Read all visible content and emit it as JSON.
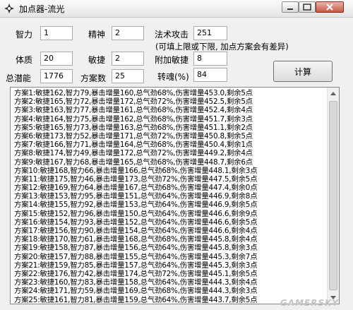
{
  "window": {
    "title": "加点器-流光"
  },
  "fields": {
    "zhili": {
      "label": "智力",
      "value": "1"
    },
    "jingshen": {
      "label": "精神",
      "value": "2"
    },
    "fashu": {
      "label": "法术攻击",
      "value": "251"
    },
    "tizhi": {
      "label": "体质",
      "value": "20"
    },
    "minjie": {
      "label": "敏捷",
      "value": "2"
    },
    "fujia": {
      "label": "附加敏捷",
      "value": "8"
    },
    "zongqianneng": {
      "label": "总潜能",
      "value": "1776"
    },
    "fanganshu": {
      "label": "方案数",
      "value": "25"
    },
    "zhuanhun": {
      "label": "转魂(%)",
      "value": "84"
    }
  },
  "hint": "(可填上限或下限, 加点方案会有差异)",
  "calc_button": "计算",
  "results": [
    "方案1:敏捷162,智力79,暴击增量160,总气劲68%,伤害增量453.0,剩余5点",
    "方案2:敏捷165,智力72,暴击增量172,总气劲72%,伤害增量452.5,剩余5点",
    "方案3:敏捷163,智力77,暴击增量161,总气劲68%,伤害增量452.4,剩余4点",
    "方案4:敏捷164,智力75,暴击增量162,总气劲68%,伤害增量451.7,剩余3点",
    "方案5:敏捷165,智力73,暴击增量163,总气劲68%,伤害增量451.1,剩余2点",
    "方案6:敏捷173,智力52,暴击增量171,总气劲72%,伤害增量450.8,剩余5点",
    "方案7:敏捷166,智力71,暴击增量164,总气劲68%,伤害增量450.4,剩余1点",
    "方案8:敏捷174,智力49,暴击增量172,总气劲72%,伤害增量449.2,剩余4点",
    "方案9:敏捷167,智力68,暴击增量165,总气劲68%,伤害增量448.7,剩余6点",
    "方案10:敏捷168,智力66,暴击增量166,总气劲68%,伤害增量448.1,剩余3点",
    "方案11:敏捷175,智力46,暴击增量173,总气劲72%,伤害增量447.5,剩余5点",
    "方案12:敏捷169,智力64,暴击增量167,总气劲68%,伤害增量447.4,剩余0点",
    "方案13:敏捷153,智力95,暴击增量151,总气劲64%,伤害增量446.9,剩余8点",
    "方案14:敏捷155,智力92,暴击增量153,总气劲64%,伤害增量446.9,剩余5点",
    "方案15:敏捷152,智力96,暴击增量150,总气劲64%,伤害增量446.6,剩余9点",
    "方案16:敏捷154,智力93,暴击增量152,总气劲64%,伤害增量446.6,剩余5点",
    "方案17:敏捷156,智力90,暴击增量154,总气劲64%,伤害增量446.6,剩余4点",
    "方案18:敏捷170,智力61,暴击增量168,总气劲68%,伤害增量445.8,剩余4点",
    "方案19:敏捷158,智力87,暴击增量156,总气劲64%,伤害增量445.8,剩余3点",
    "方案20:敏捷157,智力88,暴击增量155,总气劲64%,伤害增量445.3,剩余7点",
    "方案21:敏捷159,智力85,暴击增量157,总气劲64%,伤害增量445.3,剩余3点",
    "方案22:敏捷176,智力42,暴击增量174,总气劲72%,伤害增量445.1,剩余5点",
    "方案23:敏捷160,智力83,暴击增量158,总气劲64%,伤害增量444.3,剩余4点",
    "方案24:敏捷171,智力59,暴击增量169,总气劲68%,伤害增量444.3,剩余3点",
    "方案25:敏捷161,智力81,暴击增量159,总气劲64%,伤害增量443.7,剩余5点"
  ],
  "watermark": "GAMERSKY"
}
